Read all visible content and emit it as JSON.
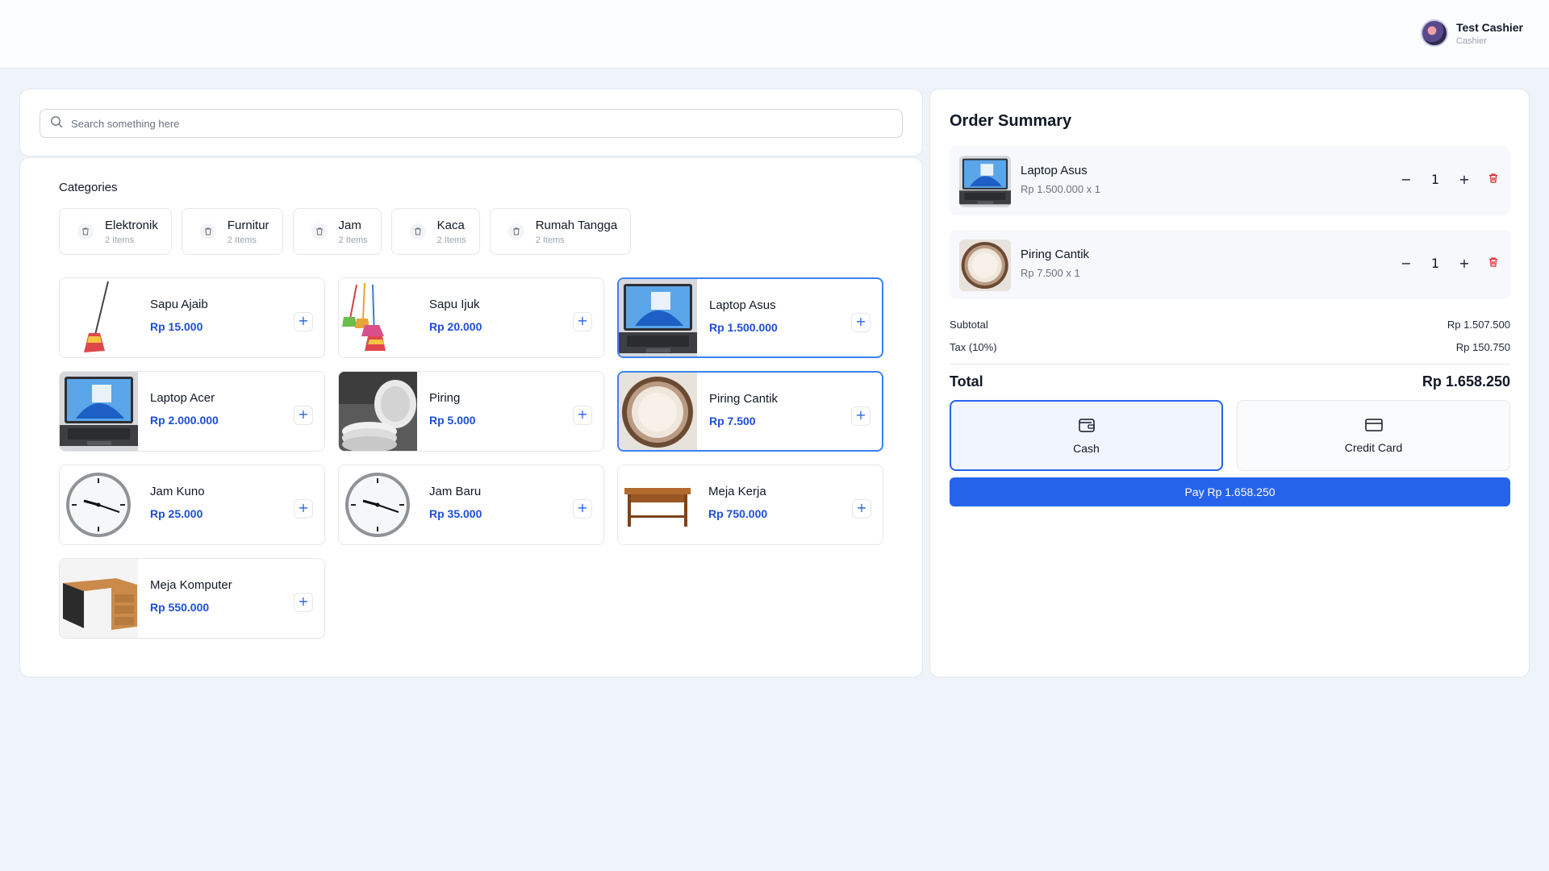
{
  "user": {
    "name": "Test Cashier",
    "role": "Cashier"
  },
  "search": {
    "placeholder": "Search something here"
  },
  "categories": {
    "title": "Categories",
    "items": [
      {
        "name": "Elektronik",
        "count": "2 Items"
      },
      {
        "name": "Furnitur",
        "count": "2 Items"
      },
      {
        "name": "Jam",
        "count": "2 Items"
      },
      {
        "name": "Kaca",
        "count": "2 Items"
      },
      {
        "name": "Rumah Tangga",
        "count": "2 Items"
      }
    ]
  },
  "products": [
    {
      "name": "Sapu Ajaib",
      "price": "Rp 15.000",
      "image": "broom",
      "selected": false
    },
    {
      "name": "Sapu Ijuk",
      "price": "Rp 20.000",
      "image": "brooms",
      "selected": false
    },
    {
      "name": "Laptop Asus",
      "price": "Rp 1.500.000",
      "image": "laptop",
      "selected": true
    },
    {
      "name": "Laptop Acer",
      "price": "Rp 2.000.000",
      "image": "laptop",
      "selected": false
    },
    {
      "name": "Piring",
      "price": "Rp 5.000",
      "image": "plates",
      "selected": false
    },
    {
      "name": "Piring Cantik",
      "price": "Rp 7.500",
      "image": "bowl",
      "selected": true
    },
    {
      "name": "Jam Kuno",
      "price": "Rp 25.000",
      "image": "clock",
      "selected": false
    },
    {
      "name": "Jam Baru",
      "price": "Rp 35.000",
      "image": "clock",
      "selected": false
    },
    {
      "name": "Meja Kerja",
      "price": "Rp 750.000",
      "image": "desk",
      "selected": false
    },
    {
      "name": "Meja Komputer",
      "price": "Rp 550.000",
      "image": "computer-desk",
      "selected": false
    }
  ],
  "order": {
    "title": "Order Summary",
    "items": [
      {
        "name": "Laptop Asus",
        "detail": "Rp 1.500.000 x 1",
        "qty": "1",
        "image": "laptop"
      },
      {
        "name": "Piring Cantik",
        "detail": "Rp 7.500 x 1",
        "qty": "1",
        "image": "bowl"
      }
    ],
    "subtotal_label": "Subtotal",
    "subtotal": "Rp 1.507.500",
    "tax_label": "Tax (10%)",
    "tax": "Rp 150.750",
    "total_label": "Total",
    "total": "Rp 1.658.250",
    "methods": [
      {
        "label": "Cash",
        "icon": "wallet-icon",
        "active": true
      },
      {
        "label": "Credit Card",
        "icon": "credit-card-icon",
        "active": false
      }
    ],
    "pay_label": "Pay Rp 1.658.250"
  },
  "colors": {
    "accent": "#2563eb",
    "price": "#1d4ed8",
    "danger": "#dc2626",
    "background": "#eff4fb"
  }
}
